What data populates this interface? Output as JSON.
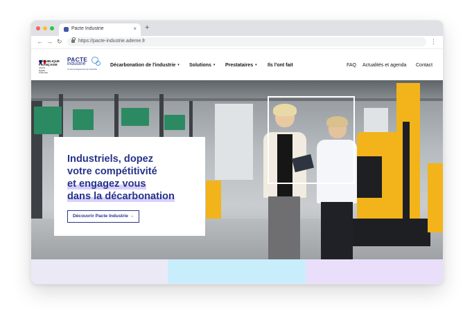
{
  "browser": {
    "tab_title": "Pacte Industrie",
    "tab_close": "×",
    "new_tab": "+",
    "back": "←",
    "forward": "→",
    "reload": "↻",
    "url": "https://pacte-industrie.ademe.fr",
    "menu": "⋮"
  },
  "header": {
    "gov_logo_text": "RÉPUBLIQUE\nFRANÇAISE",
    "gov_motto": "Liberté\nÉgalité\nFraternité",
    "brand_word": "PACTE",
    "brand_sub": "industrie",
    "brand_tagline": "Un accompagnement de l'industrie",
    "nav": [
      {
        "label": "Décarbonation de l'industrie",
        "chevron": "▾"
      },
      {
        "label": "Solutions",
        "chevron": "▾"
      },
      {
        "label": "Prestataires",
        "chevron": "▾"
      },
      {
        "label": "Ils l'ont fait",
        "chevron": ""
      }
    ],
    "secondary_nav": [
      "FAQ",
      "Actualités et agenda",
      "Contact"
    ]
  },
  "hero": {
    "line1": "Industriels, dopez",
    "line2": "votre compétitivité",
    "line3": "et engagez vous",
    "line4": "dans la décarbonation",
    "cta_label": "Découvrir Pacte Industrie",
    "cta_icon": "→"
  },
  "colors": {
    "brand_blue": "#26348a",
    "highlight": "#d8d0fb",
    "strip_1": "#ece9f7",
    "strip_2": "#c8eefb",
    "strip_3": "#eadffa"
  }
}
